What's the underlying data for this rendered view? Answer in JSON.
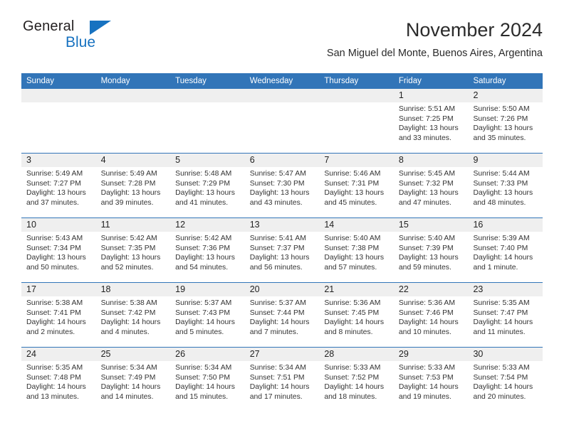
{
  "brand": {
    "name_top": "General",
    "name_bottom": "Blue",
    "accent_color": "#1772c0",
    "triangle_icon": "logo-triangle-icon"
  },
  "header": {
    "month_title": "November 2024",
    "location": "San Miguel del Monte, Buenos Aires, Argentina"
  },
  "calendar": {
    "header_color": "#3275b8",
    "daynum_band_color": "#efefef",
    "weekdays": [
      "Sunday",
      "Monday",
      "Tuesday",
      "Wednesday",
      "Thursday",
      "Friday",
      "Saturday"
    ],
    "labels": {
      "sunrise": "Sunrise:",
      "sunset": "Sunset:",
      "daylight": "Daylight:"
    },
    "weeks": [
      [
        {
          "day": "",
          "empty": true
        },
        {
          "day": "",
          "empty": true
        },
        {
          "day": "",
          "empty": true
        },
        {
          "day": "",
          "empty": true
        },
        {
          "day": "",
          "empty": true
        },
        {
          "day": "1",
          "sunrise": "Sunrise: 5:51 AM",
          "sunset": "Sunset: 7:25 PM",
          "daylight1": "Daylight: 13 hours",
          "daylight2": "and 33 minutes."
        },
        {
          "day": "2",
          "sunrise": "Sunrise: 5:50 AM",
          "sunset": "Sunset: 7:26 PM",
          "daylight1": "Daylight: 13 hours",
          "daylight2": "and 35 minutes."
        }
      ],
      [
        {
          "day": "3",
          "sunrise": "Sunrise: 5:49 AM",
          "sunset": "Sunset: 7:27 PM",
          "daylight1": "Daylight: 13 hours",
          "daylight2": "and 37 minutes."
        },
        {
          "day": "4",
          "sunrise": "Sunrise: 5:49 AM",
          "sunset": "Sunset: 7:28 PM",
          "daylight1": "Daylight: 13 hours",
          "daylight2": "and 39 minutes."
        },
        {
          "day": "5",
          "sunrise": "Sunrise: 5:48 AM",
          "sunset": "Sunset: 7:29 PM",
          "daylight1": "Daylight: 13 hours",
          "daylight2": "and 41 minutes."
        },
        {
          "day": "6",
          "sunrise": "Sunrise: 5:47 AM",
          "sunset": "Sunset: 7:30 PM",
          "daylight1": "Daylight: 13 hours",
          "daylight2": "and 43 minutes."
        },
        {
          "day": "7",
          "sunrise": "Sunrise: 5:46 AM",
          "sunset": "Sunset: 7:31 PM",
          "daylight1": "Daylight: 13 hours",
          "daylight2": "and 45 minutes."
        },
        {
          "day": "8",
          "sunrise": "Sunrise: 5:45 AM",
          "sunset": "Sunset: 7:32 PM",
          "daylight1": "Daylight: 13 hours",
          "daylight2": "and 47 minutes."
        },
        {
          "day": "9",
          "sunrise": "Sunrise: 5:44 AM",
          "sunset": "Sunset: 7:33 PM",
          "daylight1": "Daylight: 13 hours",
          "daylight2": "and 48 minutes."
        }
      ],
      [
        {
          "day": "10",
          "sunrise": "Sunrise: 5:43 AM",
          "sunset": "Sunset: 7:34 PM",
          "daylight1": "Daylight: 13 hours",
          "daylight2": "and 50 minutes."
        },
        {
          "day": "11",
          "sunrise": "Sunrise: 5:42 AM",
          "sunset": "Sunset: 7:35 PM",
          "daylight1": "Daylight: 13 hours",
          "daylight2": "and 52 minutes."
        },
        {
          "day": "12",
          "sunrise": "Sunrise: 5:42 AM",
          "sunset": "Sunset: 7:36 PM",
          "daylight1": "Daylight: 13 hours",
          "daylight2": "and 54 minutes."
        },
        {
          "day": "13",
          "sunrise": "Sunrise: 5:41 AM",
          "sunset": "Sunset: 7:37 PM",
          "daylight1": "Daylight: 13 hours",
          "daylight2": "and 56 minutes."
        },
        {
          "day": "14",
          "sunrise": "Sunrise: 5:40 AM",
          "sunset": "Sunset: 7:38 PM",
          "daylight1": "Daylight: 13 hours",
          "daylight2": "and 57 minutes."
        },
        {
          "day": "15",
          "sunrise": "Sunrise: 5:40 AM",
          "sunset": "Sunset: 7:39 PM",
          "daylight1": "Daylight: 13 hours",
          "daylight2": "and 59 minutes."
        },
        {
          "day": "16",
          "sunrise": "Sunrise: 5:39 AM",
          "sunset": "Sunset: 7:40 PM",
          "daylight1": "Daylight: 14 hours",
          "daylight2": "and 1 minute."
        }
      ],
      [
        {
          "day": "17",
          "sunrise": "Sunrise: 5:38 AM",
          "sunset": "Sunset: 7:41 PM",
          "daylight1": "Daylight: 14 hours",
          "daylight2": "and 2 minutes."
        },
        {
          "day": "18",
          "sunrise": "Sunrise: 5:38 AM",
          "sunset": "Sunset: 7:42 PM",
          "daylight1": "Daylight: 14 hours",
          "daylight2": "and 4 minutes."
        },
        {
          "day": "19",
          "sunrise": "Sunrise: 5:37 AM",
          "sunset": "Sunset: 7:43 PM",
          "daylight1": "Daylight: 14 hours",
          "daylight2": "and 5 minutes."
        },
        {
          "day": "20",
          "sunrise": "Sunrise: 5:37 AM",
          "sunset": "Sunset: 7:44 PM",
          "daylight1": "Daylight: 14 hours",
          "daylight2": "and 7 minutes."
        },
        {
          "day": "21",
          "sunrise": "Sunrise: 5:36 AM",
          "sunset": "Sunset: 7:45 PM",
          "daylight1": "Daylight: 14 hours",
          "daylight2": "and 8 minutes."
        },
        {
          "day": "22",
          "sunrise": "Sunrise: 5:36 AM",
          "sunset": "Sunset: 7:46 PM",
          "daylight1": "Daylight: 14 hours",
          "daylight2": "and 10 minutes."
        },
        {
          "day": "23",
          "sunrise": "Sunrise: 5:35 AM",
          "sunset": "Sunset: 7:47 PM",
          "daylight1": "Daylight: 14 hours",
          "daylight2": "and 11 minutes."
        }
      ],
      [
        {
          "day": "24",
          "sunrise": "Sunrise: 5:35 AM",
          "sunset": "Sunset: 7:48 PM",
          "daylight1": "Daylight: 14 hours",
          "daylight2": "and 13 minutes."
        },
        {
          "day": "25",
          "sunrise": "Sunrise: 5:34 AM",
          "sunset": "Sunset: 7:49 PM",
          "daylight1": "Daylight: 14 hours",
          "daylight2": "and 14 minutes."
        },
        {
          "day": "26",
          "sunrise": "Sunrise: 5:34 AM",
          "sunset": "Sunset: 7:50 PM",
          "daylight1": "Daylight: 14 hours",
          "daylight2": "and 15 minutes."
        },
        {
          "day": "27",
          "sunrise": "Sunrise: 5:34 AM",
          "sunset": "Sunset: 7:51 PM",
          "daylight1": "Daylight: 14 hours",
          "daylight2": "and 17 minutes."
        },
        {
          "day": "28",
          "sunrise": "Sunrise: 5:33 AM",
          "sunset": "Sunset: 7:52 PM",
          "daylight1": "Daylight: 14 hours",
          "daylight2": "and 18 minutes."
        },
        {
          "day": "29",
          "sunrise": "Sunrise: 5:33 AM",
          "sunset": "Sunset: 7:53 PM",
          "daylight1": "Daylight: 14 hours",
          "daylight2": "and 19 minutes."
        },
        {
          "day": "30",
          "sunrise": "Sunrise: 5:33 AM",
          "sunset": "Sunset: 7:54 PM",
          "daylight1": "Daylight: 14 hours",
          "daylight2": "and 20 minutes."
        }
      ]
    ]
  }
}
